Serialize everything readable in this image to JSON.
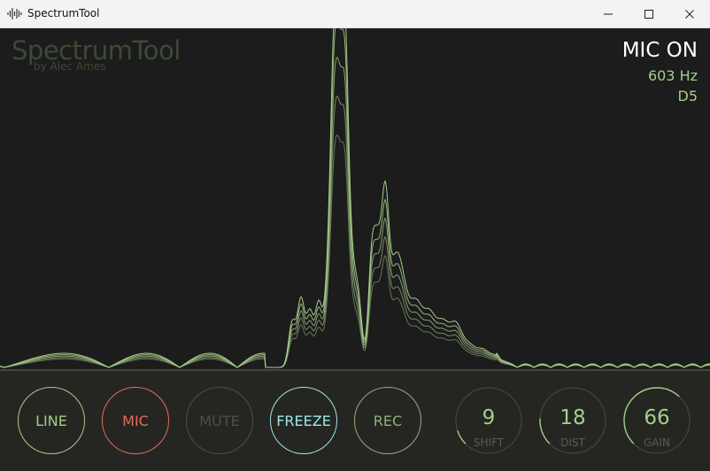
{
  "window": {
    "title": "SpectrumTool"
  },
  "brand": {
    "name": "SpectrumTool",
    "byline": "by Alec Ames"
  },
  "status": {
    "mode": "MIC ON",
    "frequency": "603 Hz",
    "note": "D5"
  },
  "colors": {
    "accent_green": "#a6cc8a",
    "line_green": "#a6cc8a",
    "mic_red": "#e86a5a",
    "freeze_cyan": "#9ee6e6",
    "mute_dim": "#4a5243",
    "rec_green": "#8fb07a",
    "background": "#1c1c1c",
    "panel": "#252622"
  },
  "controls": {
    "buttons": [
      {
        "label": "LINE",
        "color": "#a6cc8a",
        "icon": "none"
      },
      {
        "label": "MIC",
        "color": "#e86a5a",
        "icon": "none"
      },
      {
        "label": "MUTE",
        "color": "#4a5243",
        "icon": "none"
      },
      {
        "label": "FREEZE",
        "color": "#9ee6e6",
        "icon": "none"
      },
      {
        "label": "REC",
        "color": "#8fb07a",
        "icon": "none"
      }
    ],
    "knobs": [
      {
        "value": "9",
        "label": "SHIFT",
        "level": 0.1
      },
      {
        "value": "18",
        "label": "DIST",
        "level": 0.18
      },
      {
        "value": "66",
        "label": "GAIN",
        "level": 0.66
      }
    ]
  },
  "icons": {
    "app": "waveform-icon",
    "minimize": "minimize-icon",
    "maximize": "maximize-icon",
    "close": "close-icon"
  }
}
